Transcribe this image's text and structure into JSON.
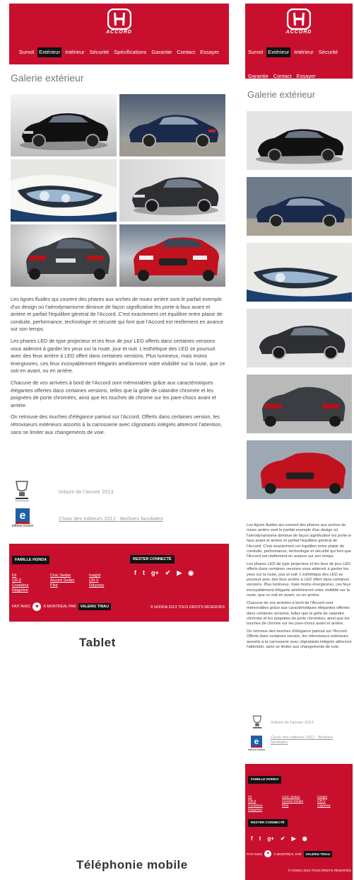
{
  "brand": {
    "model": "ACCORD",
    "logo_icon": "honda-h-logo",
    "primary_color": "#c8102e"
  },
  "nav": {
    "items": [
      "Survol",
      "Extérieur",
      "Intérieur",
      "Sécurité",
      "Spécifications",
      "Garantie",
      "Contact",
      "Essayer"
    ],
    "active": "Extérieur"
  },
  "gallery": {
    "title": "Galerie extérieur",
    "photos": [
      "car-front-three-quarter-black",
      "car-rear-three-quarter-blue",
      "headlight-closeup",
      "car-front-dark-grey",
      "car-rear-grey",
      "car-front-red"
    ]
  },
  "paragraphs": [
    "Les lignes fluides qui courent des phares aux arches de roues arrière sont le parfait exemple d'un design où l'aérodynamisme diminue de façon significative les porte-à-faux avant et arrière et parfait l'équilibre général de l'Accord. C'est exactement cet équilibre entre plaisir de conduite, performance, technologie et sécurité qui font que l'Accord est réellement en avance sur son temps.",
    "Les phares LED de type projecteur et les feux de jour LED offerts dans certaines versions vous aideront à garder les yeux sur la route, jour et nuit. L'esthétique des LED se poursuit avec des feux arrière à LED offert dans certaines versions. Plus lumineux, mais moins énergivores, ces feux incroyablement élégants amélioreront votre visibilité sur la route, que ce soit en avant, ou en arrière.",
    "Chacune de vos arrivées à bord de l'Accord sont mémorables grâce aux caractéristiques élégantes offertes dans certaines versions, telles que la grille de calandre chromée et les poignées de porte chromées, ainsi que les touches de chrome sur les pare-chocs avant et arrière.",
    "On retrouve des touches d'élégance partout sur l'Accord. Offerts dans certaines version, les rétroviseurs extérieurs assortis à la carrosserie avec clignotants intégrés attireront l'attention, sans se limiter aux changements de voie."
  ],
  "awards": [
    {
      "icon": "ajac-trophy-icon",
      "text": "Voiture de l'annee 2013"
    },
    {
      "icon": "editors-choice-icon",
      "text": "Choix des editeurs 2012 : Berlines familiales",
      "logo_caption": "editors'choice"
    }
  ],
  "footer": {
    "family_label": "FAMILLE HONDA",
    "links_col1": [
      "Fit",
      "CR-Z",
      "Crosstour",
      "Ridgeline"
    ],
    "links_col2": [
      "Civic Sedan",
      "Accord Sedan",
      "Pilot"
    ],
    "links_col3": [
      "Insight",
      "CR-V",
      "Odyssey"
    ],
    "stay_connected": "RESTER CONNECTÉ",
    "social_icons": [
      "facebook-icon",
      "twitter-icon",
      "google-plus-icon",
      "vine-icon",
      "youtube-icon",
      "rss-icon"
    ],
    "social_glyphs": [
      "f",
      "t",
      "g+",
      "✔",
      "▶",
      "◉"
    ],
    "made_with": "FAIT AVEC",
    "heart": "♥",
    "city": "À MONTRÉAL PAR",
    "agency": "VALERIU TINAU",
    "copyright": "© HONDA 2013 TOUS DROITS RÉSERVÉS"
  },
  "labels": {
    "tablet": "Tablet",
    "mobile": "Téléphonie mobile"
  }
}
